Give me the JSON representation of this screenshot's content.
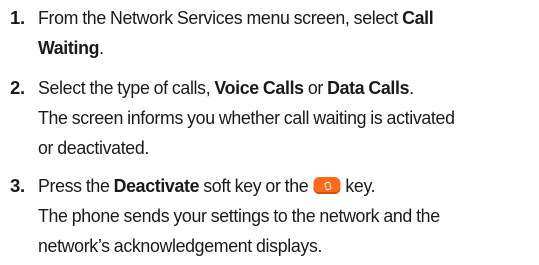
{
  "steps": [
    {
      "number": "1.",
      "lines": [
        {
          "pre": "From the Network Services menu screen, select ",
          "bold": "Call"
        },
        {
          "bold": "Waiting",
          "post": "."
        }
      ]
    },
    {
      "number": "2.",
      "lines": [
        {
          "pre": "Select the type of calls, ",
          "bold1": "Voice Calls",
          "mid": " or ",
          "bold2": "Data Calls",
          "post": "."
        },
        {
          "text": "The screen informs you whether call waiting is activated"
        },
        {
          "text": "or deactivated."
        }
      ]
    },
    {
      "number": "3.",
      "lines": [
        {
          "pre": "Press the ",
          "bold": "Deactivate",
          "post": " soft key or the ",
          "icon": "end-key-icon",
          "post2": " key."
        },
        {
          "text": "The phone sends your settings to the network and the"
        },
        {
          "text": "network’s acknowledgement displays."
        }
      ]
    }
  ],
  "colors": {
    "text": "#1a1a1a",
    "key_icon": "#ff6a1a"
  }
}
